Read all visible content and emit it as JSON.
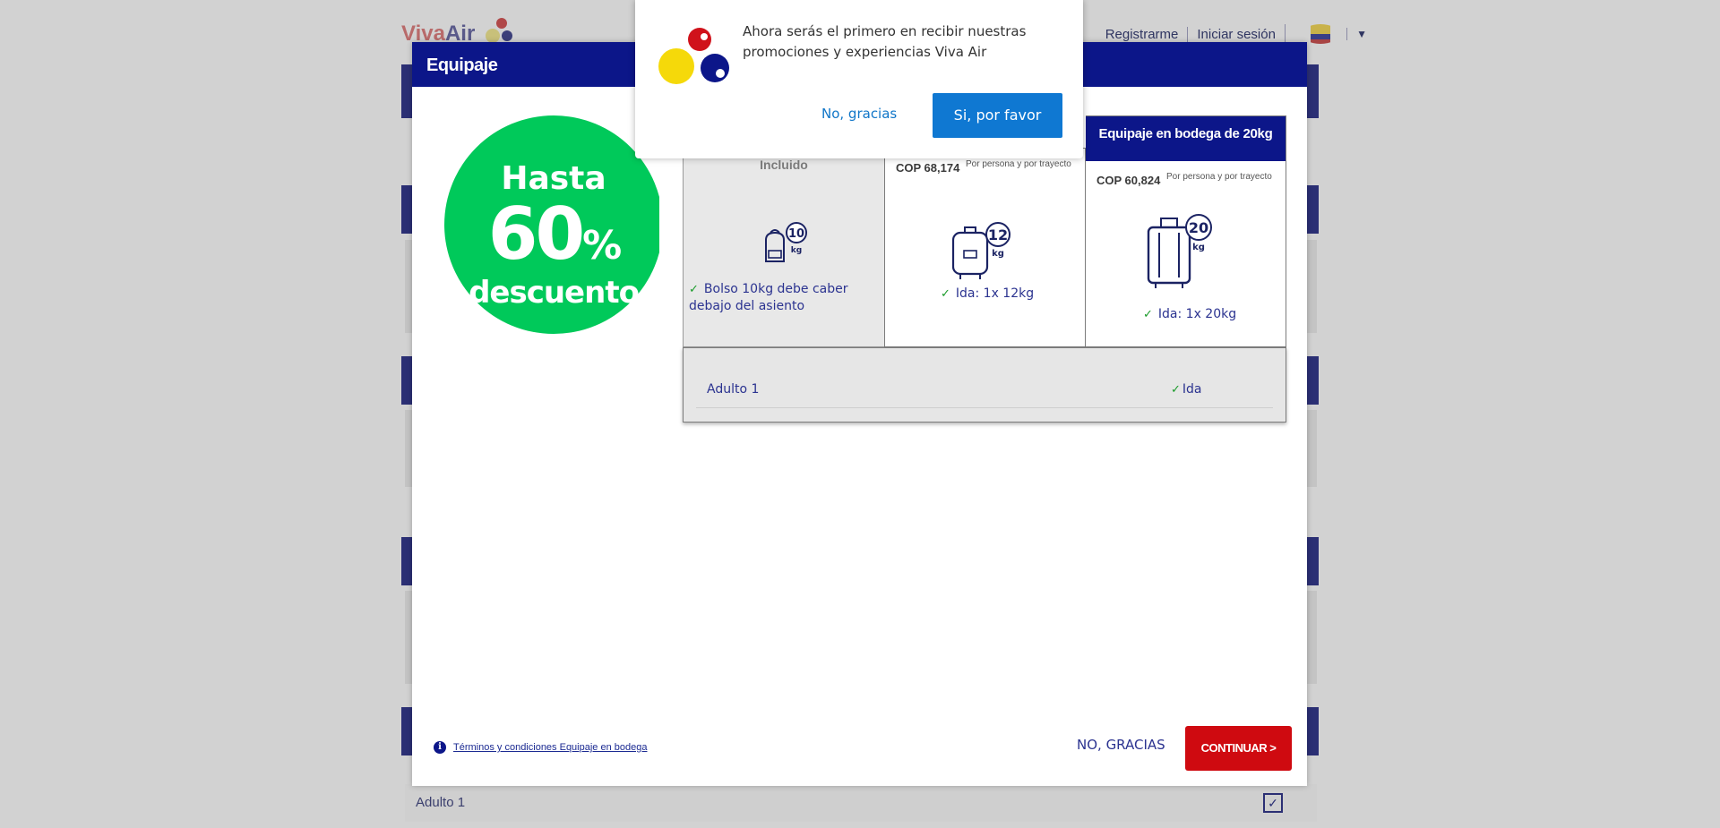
{
  "background": {
    "logo_viva": "Viva",
    "logo_air": "Air",
    "nav_register": "Registrarme",
    "nav_login": "Iniciar sesión",
    "bottom_row_label": "Adulto 1",
    "bottom_row_check": "✓"
  },
  "modal": {
    "title": "Equipaje",
    "promo": {
      "line1": "Hasta",
      "line2": "60",
      "line2_suffix": "%",
      "line3": "descuento"
    },
    "columns": {
      "included": {
        "label": "Incluido",
        "weight": "10",
        "unit": "kg",
        "check_text": "Bolso 10kg debe caber debajo del asiento"
      },
      "bag12": {
        "price": "COP 68,174",
        "price_note": "Por persona y por trayecto",
        "weight": "12",
        "unit": "kg",
        "check_text": "Ida: 1x 12kg"
      },
      "bag20": {
        "header": "Equipaje en bodega de 20kg",
        "price": "COP 60,824",
        "price_note": "Por persona y por trayecto",
        "weight": "20",
        "unit": "kg",
        "check_text": "Ida: 1x 20kg"
      }
    },
    "passengers": [
      {
        "name": "Adulto 1",
        "leg": "Ida"
      }
    ],
    "terms_link": "Términos y condiciones Equipaje en bodega",
    "no_thanks": "NO, GRACIAS",
    "continue": "CONTINUAR >"
  },
  "push_prompt": {
    "message": "Ahora serás el primero en recibir nuestras promociones y experiencias Viva Air",
    "decline": "No, gracias",
    "accept": "Si, por favor"
  },
  "colors": {
    "brand_blue": "#0c1689",
    "promo_green": "#00c95a",
    "continue_red": "#cf0a10",
    "push_button_blue": "#0f78d2",
    "logo_red": "#d0121b",
    "logo_yellow": "#f5d90a"
  }
}
